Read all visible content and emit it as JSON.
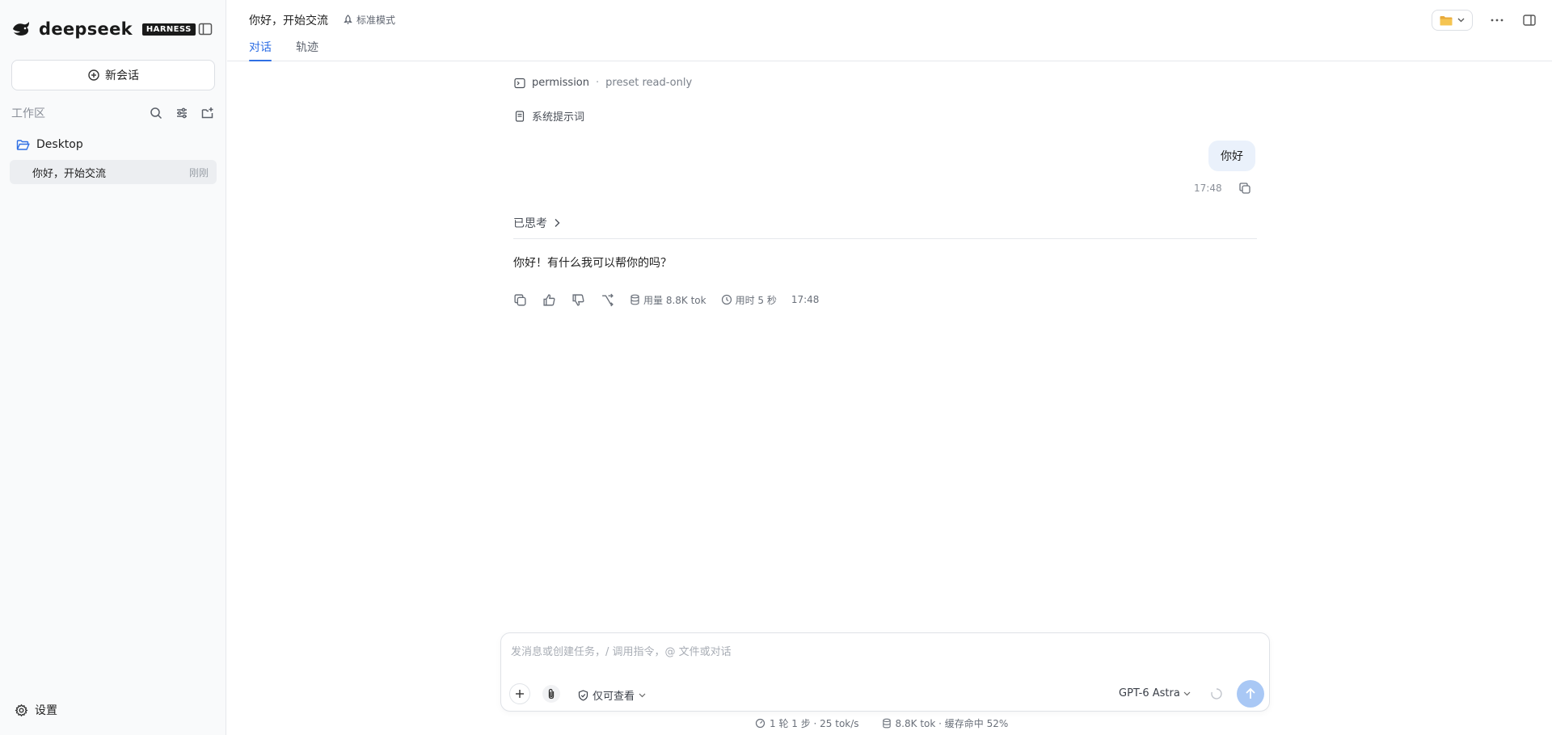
{
  "sidebar": {
    "brand_name": "deepseek",
    "brand_badge": "HARNESS",
    "new_chat_label": "新会话",
    "workspace_label": "工作区",
    "folder_name": "Desktop",
    "conversations": [
      {
        "title": "你好，开始交流",
        "time": "刚刚"
      }
    ],
    "settings_label": "设置"
  },
  "header": {
    "title": "你好，开始交流",
    "mode_label": "标准模式",
    "tabs": [
      {
        "label": "对话",
        "active": true
      },
      {
        "label": "轨迹",
        "active": false
      }
    ]
  },
  "conversation": {
    "permission_label": "permission",
    "permission_value": "preset read-only",
    "system_prompt_label": "系统提示词",
    "user_message": "你好",
    "user_time": "17:48",
    "thought_label": "已思考",
    "assistant_reply": "你好！有什么我可以帮你的吗？",
    "usage": "用量 8.8K tok",
    "duration": "用时 5 秒",
    "reply_time": "17:48"
  },
  "composer": {
    "placeholder": "发消息或创建任务，/ 调用指令，@ 文件或对话",
    "value": "",
    "permission_mode": "仅可查看",
    "model": "GPT-6 Astra"
  },
  "footer": {
    "rounds": "1 轮 1 步 · 25 tok/s",
    "tokens": "8.8K tok · 缓存命中 52%"
  },
  "colors": {
    "accent": "#2f6fe4",
    "user_bubble": "#eaf1fb",
    "send_button": "#a9c8f5",
    "sidebar_bg": "#f9fafb",
    "folder_icon": "#e8a93a"
  }
}
